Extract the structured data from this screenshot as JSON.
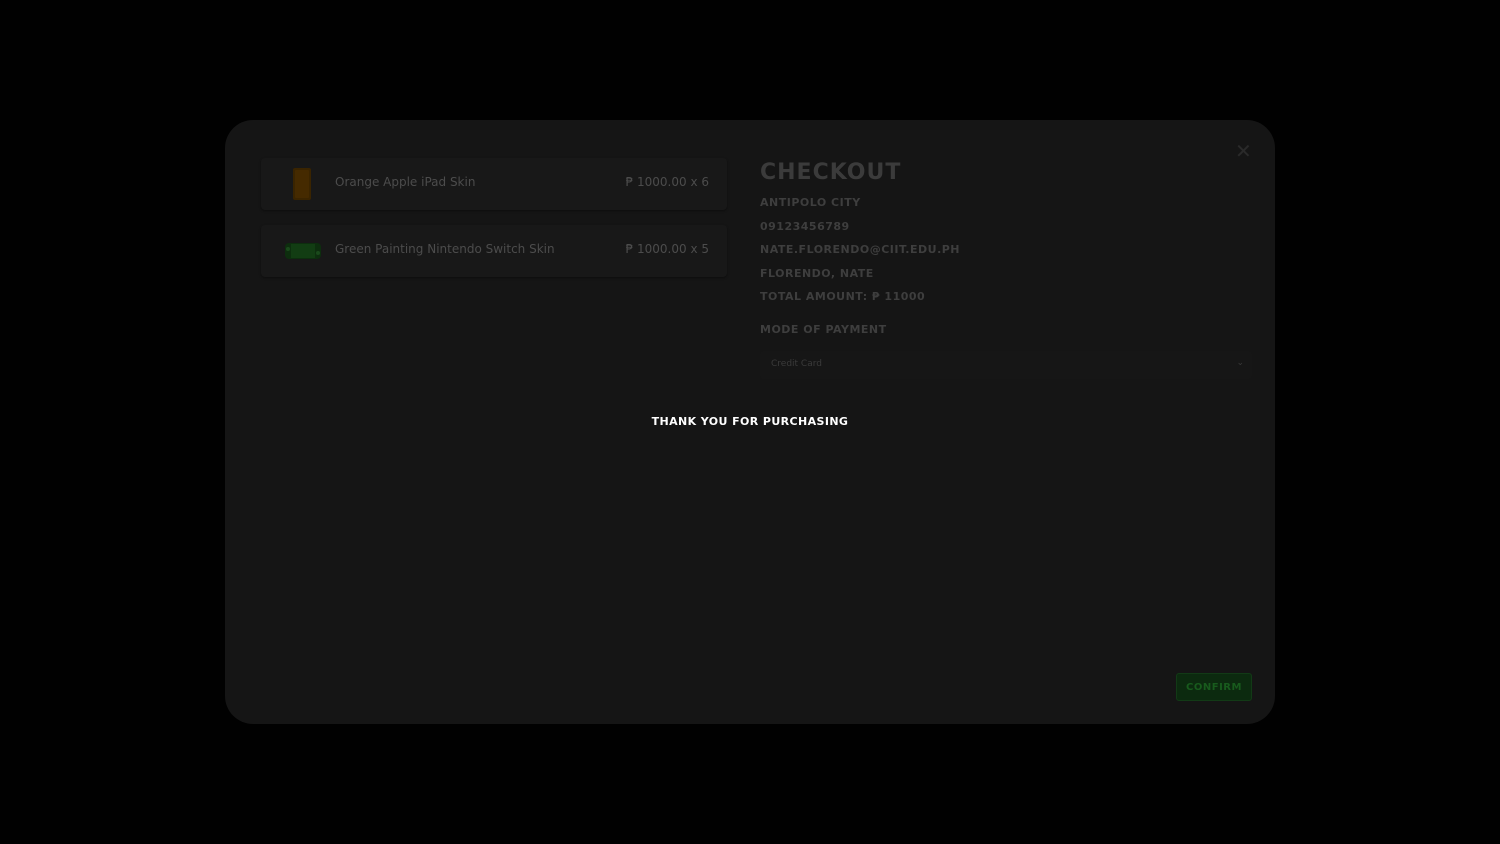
{
  "checkout": {
    "title": "CHECKOUT",
    "close_icon": "close-icon",
    "city": "ANTIPOLO CITY",
    "phone": "09123456789",
    "email": "NATE.FLORENDO@CIIT.EDU.PH",
    "name": "FLORENDO, NATE",
    "total": "TOTAL AMOUNT: ₱ 11000",
    "payment_label": "MODE OF PAYMENT",
    "payment_selected": "Credit Card",
    "confirm_label": "CONFIRM"
  },
  "cart": {
    "items": [
      {
        "name": "Orange Apple iPad Skin",
        "price": "₱ 1000.00 x 6",
        "thumb_color": "#3a2200"
      },
      {
        "name": "Green Painting Nintendo Switch Skin",
        "price": "₱ 1000.00 x 5",
        "thumb_color": "#0f3a10"
      }
    ]
  },
  "message": {
    "thanks": "THANK YOU FOR PURCHASING"
  },
  "colors": {
    "backdrop": "#000000",
    "modal_bg": "#151515",
    "confirm_green": "#185b1d",
    "text_white": "#ffffff"
  }
}
